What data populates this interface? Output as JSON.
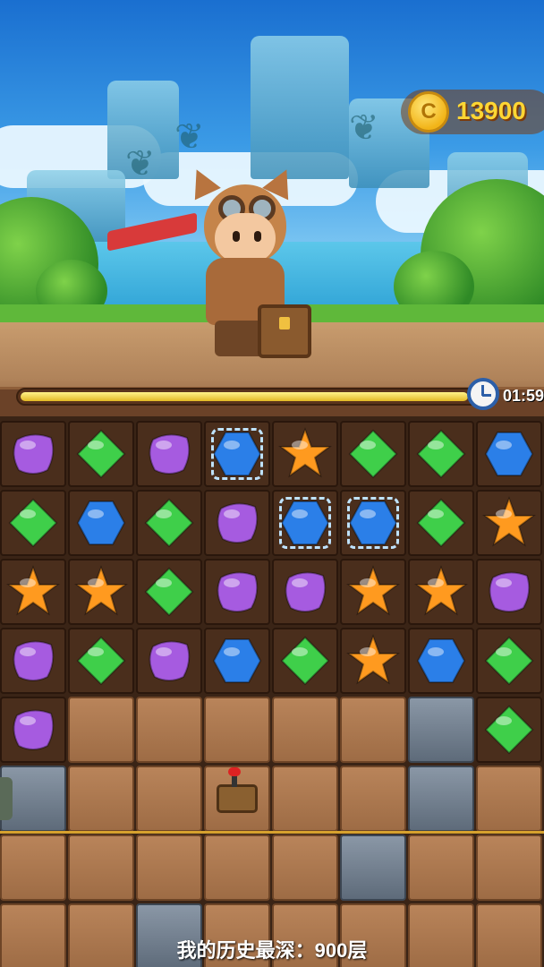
{
  "hud": {
    "coins": "13900",
    "coin_symbol": "C",
    "timer": "01:59",
    "time_progress": 0.98
  },
  "board": {
    "columns": 8,
    "rows": [
      [
        "purple",
        "green",
        "purple",
        "blue",
        "orange",
        "green",
        "green",
        "blue"
      ],
      [
        "green",
        "blue",
        "green",
        "purple",
        "blue",
        "blue",
        "green",
        "orange"
      ],
      [
        "orange",
        "orange",
        "green",
        "purple",
        "purple",
        "orange",
        "orange",
        "purple"
      ],
      [
        "purple",
        "green",
        "purple",
        "blue",
        "green",
        "orange",
        "blue",
        "green"
      ],
      [
        "purple",
        "dirt",
        "dirt",
        "dirt",
        "dirt",
        "dirt",
        "stone",
        "green"
      ],
      [
        "stone",
        "dirt",
        "dirt",
        "detonator",
        "dirt",
        "dirt",
        "stone",
        "dirt"
      ],
      [
        "dirt",
        "dirt",
        "dirt",
        "dirt",
        "dirt",
        "stone",
        "dirt",
        "dirt"
      ],
      [
        "dirt",
        "dirt",
        "stone",
        "dirt",
        "dirt",
        "dirt",
        "dirt",
        "dirt"
      ]
    ],
    "selected": [
      [
        0,
        3
      ],
      [
        1,
        4
      ],
      [
        1,
        5
      ]
    ]
  },
  "footer": {
    "depth_record": "我的历史最深：900层"
  },
  "colors": {
    "purple": "#a65be0",
    "green": "#3fcf4a",
    "blue": "#2b7fe8",
    "orange": "#ff9a1f"
  }
}
